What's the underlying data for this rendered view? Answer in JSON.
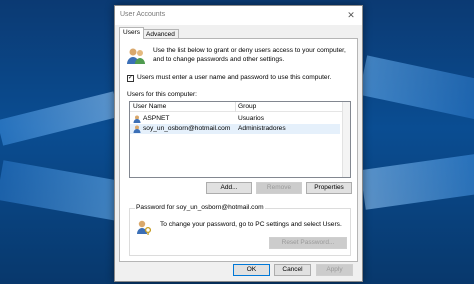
{
  "dialog": {
    "title": "User Accounts",
    "close_glyph": "✕",
    "tabs": [
      {
        "label": "Users",
        "active": true
      },
      {
        "label": "Advanced",
        "active": false
      }
    ],
    "intro_text": "Use the list below to grant or deny users access to your computer, and to change passwords and other settings.",
    "must_enter_checkbox": {
      "checked": true,
      "check_glyph": "✓",
      "label": "Users must enter a user name and password to use this computer."
    },
    "users_section_label": "Users for this computer:",
    "columns": [
      "User Name",
      "Group"
    ],
    "rows": [
      {
        "user": "ASPNET",
        "group": "Usuarios",
        "selected": false
      },
      {
        "user": "soy_un_osborn@hotmail.com",
        "group": "Administradores",
        "selected": true
      }
    ],
    "buttons": {
      "add": "Add...",
      "remove": "Remove",
      "properties": "Properties",
      "reset_password": "Reset Password...",
      "ok": "OK",
      "cancel": "Cancel",
      "apply": "Apply"
    },
    "password_group_title": "Password for soy_un_osborn@hotmail.com",
    "password_text": "To change your password, go to PC settings and select Users.",
    "icons": {
      "users": "users-icon",
      "user_row": "user-icon",
      "password": "password-icon",
      "close": "close-icon"
    }
  },
  "colors": {
    "desktop_bg": "#0a4d92",
    "dialog_bg": "#f0f0f0",
    "selection": "#e5f0fb",
    "default_button_border": "#0078d7"
  }
}
